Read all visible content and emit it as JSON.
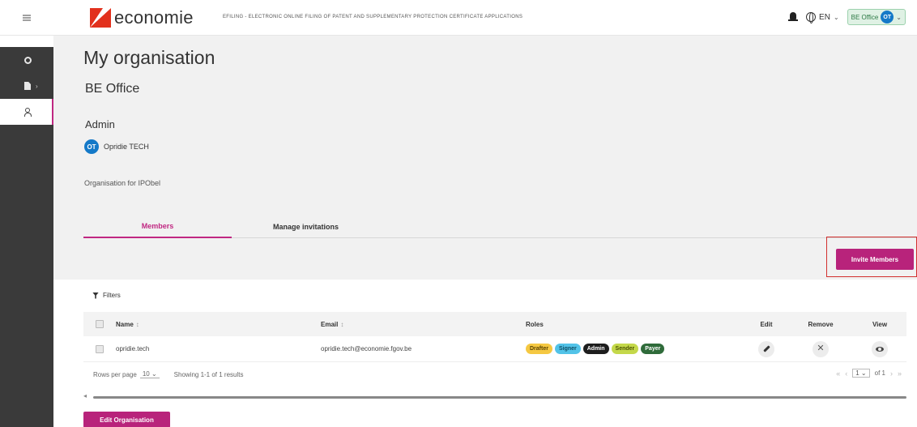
{
  "header": {
    "brand": "economie",
    "app_title": "EFILING - ELECTRONIC ONLINE FILING OF PATENT AND SUPPLEMENTARY PROTECTION CERTIFICATE APPLICATIONS",
    "language": "EN",
    "org_chip": "BE Office",
    "user_initials": "OT",
    "icons": [
      "menu-icon",
      "bell-icon",
      "globe-icon",
      "chevron-down-icon"
    ]
  },
  "sidebar": {
    "items": [
      {
        "name": "dashboard",
        "icon": "circle-icon"
      },
      {
        "name": "documents",
        "icon": "document-icon"
      },
      {
        "name": "organisation",
        "icon": "users-icon"
      }
    ]
  },
  "page": {
    "title": "My organisation",
    "org_name": "BE Office",
    "admin_heading": "Admin",
    "admin_initials": "OT",
    "admin_name": "Opridie TECH",
    "description": "Organisation for IPObel"
  },
  "tabs": [
    {
      "label": "Members",
      "active": true
    },
    {
      "label": "Manage invitations",
      "active": false
    }
  ],
  "actions": {
    "invite": "Invite Members",
    "edit_org": "Edit Organisation"
  },
  "filters_label": "Filters",
  "table": {
    "columns": [
      "Name",
      "Email",
      "Roles",
      "Edit",
      "Remove",
      "View"
    ],
    "rows": [
      {
        "name": "opridie.tech",
        "email": "opridie.tech@economie.fgov.be",
        "roles": [
          {
            "label": "Drafter",
            "bg": "#f5c842",
            "fg": "#5a4300"
          },
          {
            "label": "Signer",
            "bg": "#52c3e8",
            "fg": "#0d4d63"
          },
          {
            "label": "Admin",
            "bg": "#1e1e1e",
            "fg": "#ffffff"
          },
          {
            "label": "Sender",
            "bg": "#c4d84a",
            "fg": "#4a5300"
          },
          {
            "label": "Payer",
            "bg": "#2f6b3a",
            "fg": "#ffffff"
          }
        ]
      }
    ],
    "footer": {
      "rows_per_page_label": "Rows per page",
      "rows_per_page_value": "10",
      "showing": "Showing 1-1 of 1 results",
      "page_value": "1",
      "page_of": "of 1"
    }
  },
  "colors": {
    "accent": "#b8237b",
    "highlight": "#d2302f",
    "sidebar": "#3a3a3a"
  }
}
